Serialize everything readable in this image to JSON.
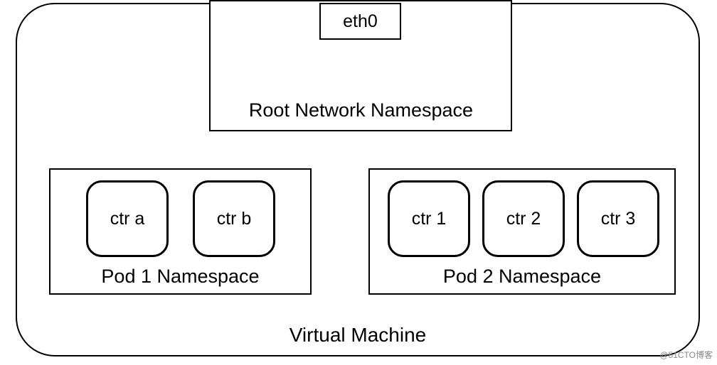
{
  "vm": {
    "label": "Virtual Machine"
  },
  "rootNamespace": {
    "interface": "eth0",
    "label": "Root Network Namespace"
  },
  "pods": {
    "pod1": {
      "label": "Pod 1 Namespace",
      "containers": {
        "a": "ctr a",
        "b": "ctr b"
      }
    },
    "pod2": {
      "label": "Pod 2 Namespace",
      "containers": {
        "c1": "ctr 1",
        "c2": "ctr 2",
        "c3": "ctr 3"
      }
    }
  },
  "watermark": "@51CTO博客"
}
